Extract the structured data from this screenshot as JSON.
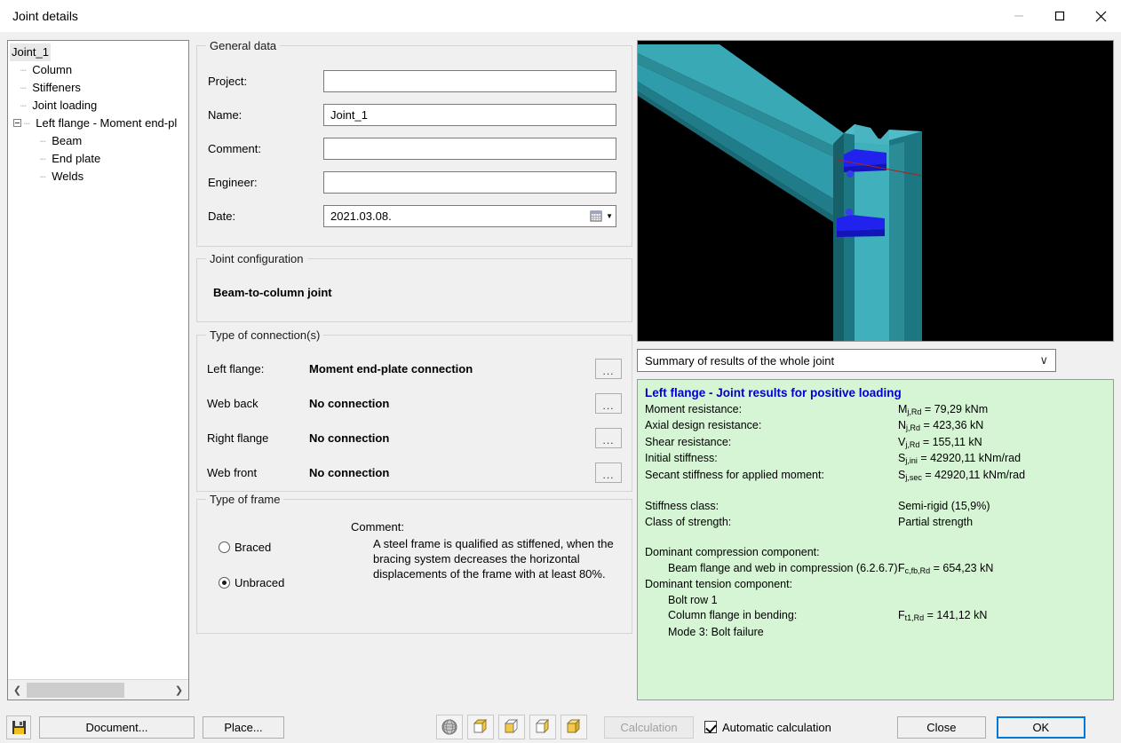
{
  "window": {
    "title": "Joint details",
    "controls": {
      "minimize": "minimize-icon",
      "maximize": "maximize-icon",
      "close": "close-icon"
    }
  },
  "tree": {
    "nodes": [
      {
        "label": "Joint_1",
        "level": 0,
        "selected": true,
        "expander": false
      },
      {
        "label": "Column",
        "level": 1,
        "selected": false,
        "expander": false
      },
      {
        "label": "Stiffeners",
        "level": 1,
        "selected": false,
        "expander": false
      },
      {
        "label": "Joint loading",
        "level": 1,
        "selected": false,
        "expander": false
      },
      {
        "label": "Left flange - Moment end-pl",
        "level": 1,
        "selected": false,
        "expander": true
      },
      {
        "label": "Beam",
        "level": 2,
        "selected": false,
        "expander": false
      },
      {
        "label": "End plate",
        "level": 2,
        "selected": false,
        "expander": false
      },
      {
        "label": "Welds",
        "level": 2,
        "selected": false,
        "expander": false
      }
    ],
    "scrollbar": {
      "left_arrow": "❮",
      "right_arrow": "❯"
    }
  },
  "general_data": {
    "title": "General data",
    "fields": [
      {
        "label": "Project:",
        "value": ""
      },
      {
        "label": "Name:",
        "value": "Joint_1"
      },
      {
        "label": "Comment:",
        "value": ""
      },
      {
        "label": "Engineer:",
        "value": ""
      }
    ],
    "date": {
      "label": "Date:",
      "value": "2021.03.08.",
      "picker_icon": "calendar-icon",
      "chevron": "▼"
    }
  },
  "joint_configuration": {
    "title": "Joint configuration",
    "value": "Beam-to-column joint"
  },
  "connections": {
    "title": "Type of connection(s)",
    "rows": [
      {
        "label": "Left flange:",
        "value": "Moment end-plate connection",
        "button": "..."
      },
      {
        "label": "Web back",
        "value": "No connection",
        "button": "..."
      },
      {
        "label": "Right flange",
        "value": "No connection",
        "button": "..."
      },
      {
        "label": "Web front",
        "value": "No connection",
        "button": "..."
      }
    ]
  },
  "frame": {
    "title": "Type of frame",
    "options": [
      {
        "label": "Braced",
        "selected": false
      },
      {
        "label": "Unbraced",
        "selected": true
      }
    ],
    "comment_title": "Comment:",
    "comment_body": "A steel frame is qualified as stiffened, when the bracing system decreases the horizontal displacements of the frame with at least 80%."
  },
  "viewport": {
    "name": "3d-joint-model",
    "background": "#000000",
    "beam_color": "#2e9caa",
    "beam_color_dark": "#1d7480",
    "beam_color_light": "#57bfc9",
    "stiffener_color": "#2222ee",
    "axis_color": "#aa2222"
  },
  "results_selector": {
    "value": "Summary of results of the whole joint",
    "chevron": "∨"
  },
  "results": {
    "title": "Left flange - Joint results for positive loading",
    "title_color": "#0000cc",
    "background": "#d5f5d5",
    "lines": [
      {
        "label": "Moment resistance:",
        "sym": "M",
        "sub": "j,Rd",
        "value": " = 79,29 kNm",
        "indent": false
      },
      {
        "label": "Axial design resistance:",
        "sym": "N",
        "sub": "j,Rd",
        "value": " = 423,36 kN",
        "indent": false
      },
      {
        "label": "Shear resistance:",
        "sym": "V",
        "sub": "j,Rd",
        "value": " = 155,11 kN",
        "indent": false
      },
      {
        "label": "Initial stiffness:",
        "sym": "S",
        "sub": "j,ini",
        "value": " = 42920,11 kNm/rad",
        "indent": false
      },
      {
        "label": "Secant stiffness for applied moment:",
        "sym": "S",
        "sub": "j,sec",
        "value": " = 42920,11 kNm/rad",
        "indent": false
      },
      {
        "gap": true
      },
      {
        "label": "Stiffness class:",
        "sym": "",
        "sub": "",
        "value": "Semi-rigid (15,9%)",
        "indent": false
      },
      {
        "label": "Class of strength:",
        "sym": "",
        "sub": "",
        "value": "Partial strength",
        "indent": false
      },
      {
        "gap": true
      },
      {
        "label": "Dominant compression component:",
        "sym": "",
        "sub": "",
        "value": "",
        "indent": false
      },
      {
        "label": "Beam flange and web in compression (6.2.6.7):",
        "sym": "F",
        "sub": "c,fb,Rd",
        "value": " = 654,23 kN",
        "indent": true
      },
      {
        "label": "Dominant tension component:",
        "sym": "",
        "sub": "",
        "value": "",
        "indent": false
      },
      {
        "label": "Bolt row 1",
        "sym": "",
        "sub": "",
        "value": "",
        "indent": true
      },
      {
        "label": "Column flange in bending:",
        "sym": "F",
        "sub": "t1,Rd",
        "value": " = 141,12 kN",
        "indent": true
      },
      {
        "label": "Mode 3: Bolt failure",
        "sym": "",
        "sub": "",
        "value": "",
        "indent": true
      }
    ]
  },
  "bottombar": {
    "save_icon": "save-icon",
    "document_label": "Document...",
    "place_label": "Place...",
    "view_icons": [
      "wireframe-sphere-icon",
      "wireframe-cube-icon",
      "shaded-cube-icon",
      "hidden-line-cube-icon",
      "solid-cube-icon"
    ],
    "calculation_label": "Calculation",
    "calculation_disabled": true,
    "auto_calc_label": "Automatic calculation",
    "auto_calc_checked": true,
    "close_label": "Close",
    "ok_label": "OK",
    "accent": "#0078d7"
  }
}
